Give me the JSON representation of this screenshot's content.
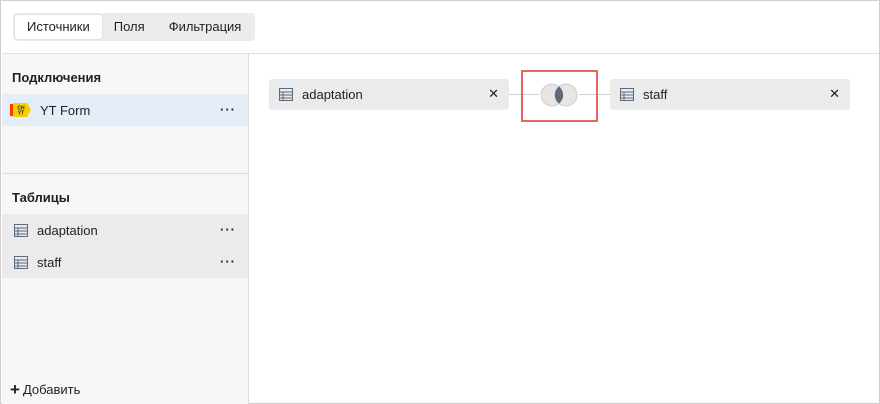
{
  "tabs": [
    {
      "label": "Источники",
      "active": true
    },
    {
      "label": "Поля",
      "active": false
    },
    {
      "label": "Фильтрация",
      "active": false
    }
  ],
  "sidebar": {
    "connections_title": "Подключения",
    "connection": {
      "label": "YT Form",
      "icon": "ch-yt-icon",
      "icon_text": "CH YT"
    },
    "tables_title": "Таблицы",
    "tables": [
      {
        "label": "adaptation",
        "icon": "table-icon"
      },
      {
        "label": "staff",
        "icon": "table-icon"
      }
    ],
    "add_label": "Добавить"
  },
  "canvas": {
    "left_node": {
      "label": "adaptation",
      "icon": "table-icon"
    },
    "right_node": {
      "label": "staff",
      "icon": "table-icon"
    },
    "join": {
      "icon": "inner-join-icon",
      "highlight_color": "#e8675a"
    }
  },
  "colors": {
    "accent_bg": "#e5eef8",
    "node_bg": "#ebebeb",
    "connector_badge": "#f5d000"
  }
}
